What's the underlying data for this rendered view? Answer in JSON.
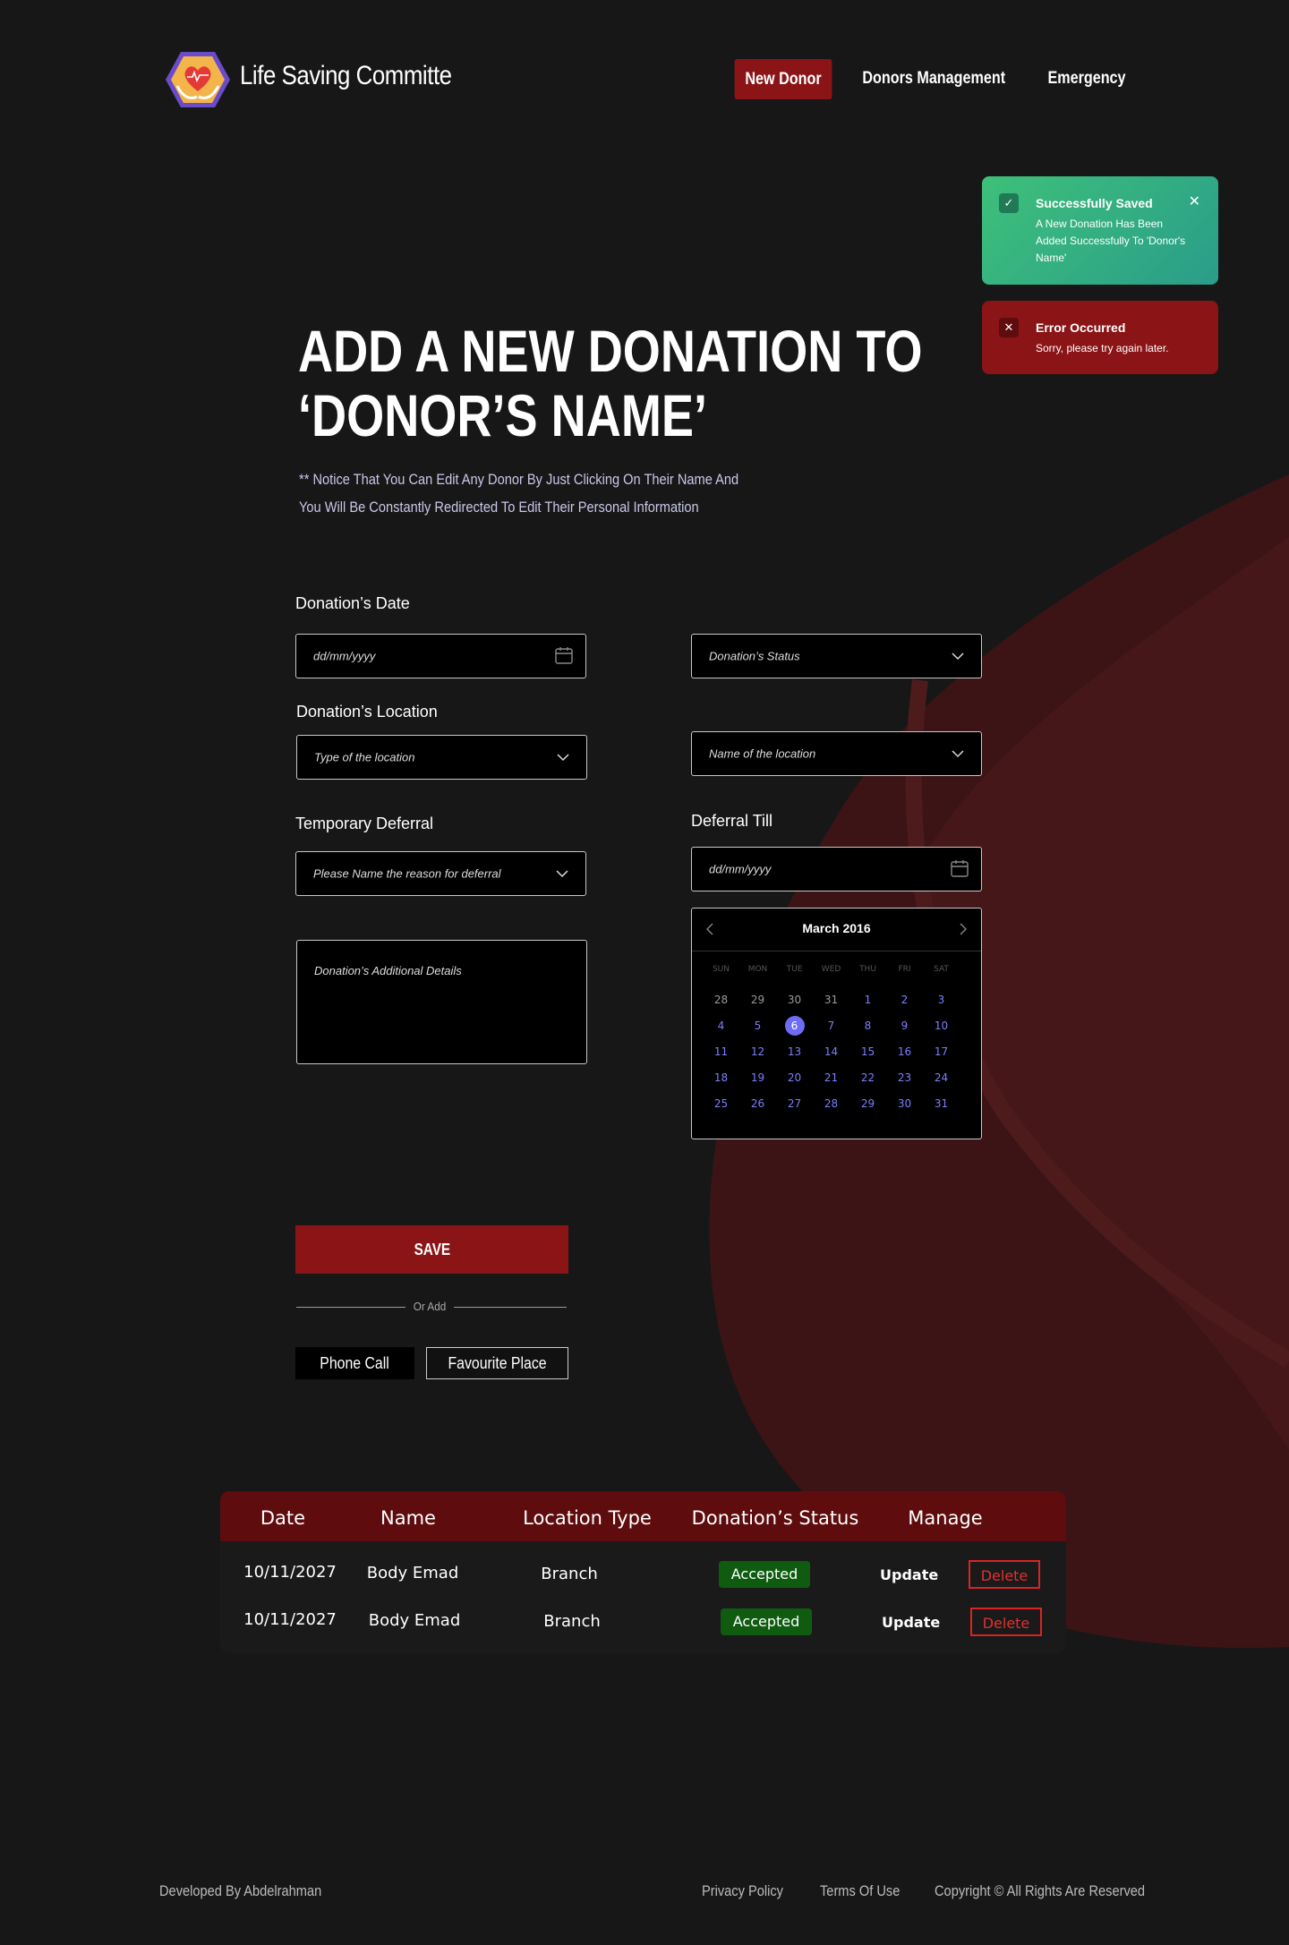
{
  "header": {
    "brand": "Life Saving Committe",
    "nav": {
      "new_donor": "New Donor",
      "donors_management": "Donors Management",
      "emergency": "Emergency"
    }
  },
  "toasts": {
    "success": {
      "title": "Successfully Saved",
      "message": "A New Donation Has Been Added Successfully To 'Donor's Name'",
      "icon": "check-icon"
    },
    "error": {
      "title": "Error Occurred",
      "message": "Sorry, please try again later.",
      "icon": "x-icon"
    }
  },
  "headline": {
    "line1": "ADD A NEW  DONATION TO",
    "line2": "‘DONOR’S NAME’"
  },
  "notice": {
    "line1": "** Notice That You Can Edit Any Donor By Just Clicking On Their Name And",
    "line2": "You Will Be Constantly Redirected To Edit Their Personal Information"
  },
  "form": {
    "donation_date_label": "Donation’s Date",
    "donation_date_placeholder": "dd/mm/yyyy",
    "donation_status_placeholder": "Donation’s Status",
    "donation_location_label": "Donation’s Location",
    "location_type_placeholder": "Type of the location",
    "location_name_placeholder": "Name of the location",
    "temporary_deferral_label": "Temporary Deferral",
    "deferral_reason_placeholder": "Please Name the reason for deferral",
    "deferral_till_label": "Deferral Till",
    "deferral_till_placeholder": "dd/mm/yyyy",
    "additional_details_placeholder": "Donation’s Additional Details"
  },
  "calendar": {
    "title": "March 2016",
    "weekdays": [
      "SUN",
      "MON",
      "TUE",
      "WED",
      "THU",
      "FRI",
      "SAT"
    ],
    "weeks": [
      [
        {
          "d": "28",
          "m": true
        },
        {
          "d": "29",
          "m": true
        },
        {
          "d": "30",
          "m": true
        },
        {
          "d": "31",
          "m": true
        },
        {
          "d": "1"
        },
        {
          "d": "2"
        },
        {
          "d": "3"
        }
      ],
      [
        {
          "d": "4"
        },
        {
          "d": "5"
        },
        {
          "d": "6",
          "s": true
        },
        {
          "d": "7"
        },
        {
          "d": "8"
        },
        {
          "d": "9"
        },
        {
          "d": "10"
        }
      ],
      [
        {
          "d": "11"
        },
        {
          "d": "12"
        },
        {
          "d": "13"
        },
        {
          "d": "14"
        },
        {
          "d": "15"
        },
        {
          "d": "16"
        },
        {
          "d": "17"
        }
      ],
      [
        {
          "d": "18"
        },
        {
          "d": "19"
        },
        {
          "d": "20"
        },
        {
          "d": "21"
        },
        {
          "d": "22"
        },
        {
          "d": "23"
        },
        {
          "d": "24"
        }
      ],
      [
        {
          "d": "25"
        },
        {
          "d": "26"
        },
        {
          "d": "27"
        },
        {
          "d": "28"
        },
        {
          "d": "29"
        },
        {
          "d": "30"
        },
        {
          "d": "31"
        }
      ]
    ]
  },
  "actions": {
    "save": "SAVE",
    "or_add": "Or Add",
    "phone_call": "Phone Call",
    "favourite_place": "Favourite Place"
  },
  "table": {
    "headers": [
      "Date",
      "Name",
      "Location Type",
      "Donation’s Status",
      "Manage"
    ],
    "rows": [
      {
        "date": "10/11/2027",
        "name": "Body Emad",
        "location_type": "Branch",
        "status": "Accepted",
        "update": "Update",
        "delete": "Delete"
      },
      {
        "date": "10/11/2027",
        "name": "Body Emad",
        "location_type": "Branch",
        "status": "Accepted",
        "update": "Update",
        "delete": "Delete"
      }
    ]
  },
  "footer": {
    "developer": "Developed By Abdelrahman",
    "privacy": "Privacy Policy",
    "terms": "Terms Of Use",
    "copyright": "Copyright © All Rights Are Reserved"
  },
  "colors": {
    "accent": "#8b1416",
    "success": "#3ec07a",
    "status_badge": "#0f5c11",
    "background": "#171717",
    "calendar_accent": "#6e6cf5"
  }
}
